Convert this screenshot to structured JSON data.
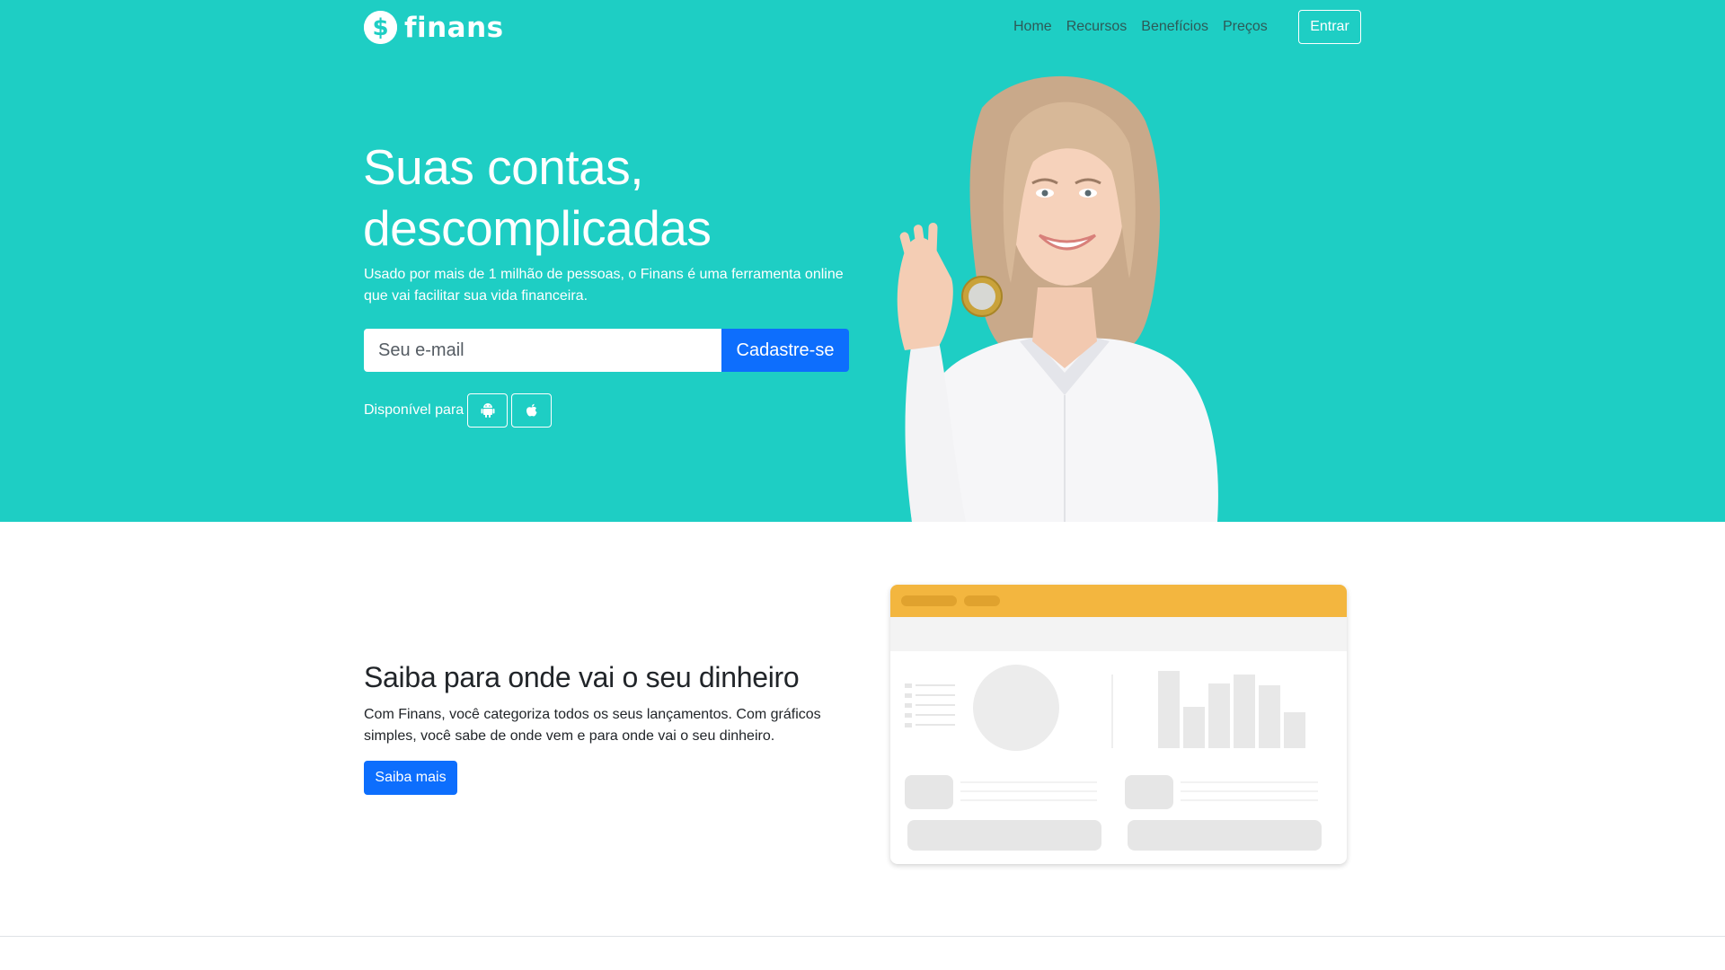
{
  "colors": {
    "hero_bg": "#1ecec4",
    "primary": "#0d6efd",
    "mockup_header": "#f3b63f"
  },
  "brand": {
    "name": "finans",
    "icon": "dollar-icon"
  },
  "nav": {
    "links": [
      "Home",
      "Recursos",
      "Benefícios",
      "Preços"
    ],
    "login_label": "Entrar"
  },
  "hero": {
    "title": "Suas contas, descomplicadas",
    "subtitle": "Usado por mais de 1 milhão de pessoas, o Finans é uma ferramenta online que vai facilitar sua vida financeira.",
    "email_placeholder": "Seu e-mail",
    "signup_label": "Cadastre-se",
    "available_label": "Disponível para",
    "stores": [
      "android-icon",
      "apple-icon"
    ]
  },
  "feature": {
    "title": "Saiba para onde vai o seu dinheiro",
    "text": "Com Finans, você categoriza todos os seus lançamentos. Com gráficos simples, você sabe de onde vem e para onde vai o seu dinheiro.",
    "button_label": "Saiba mais"
  }
}
